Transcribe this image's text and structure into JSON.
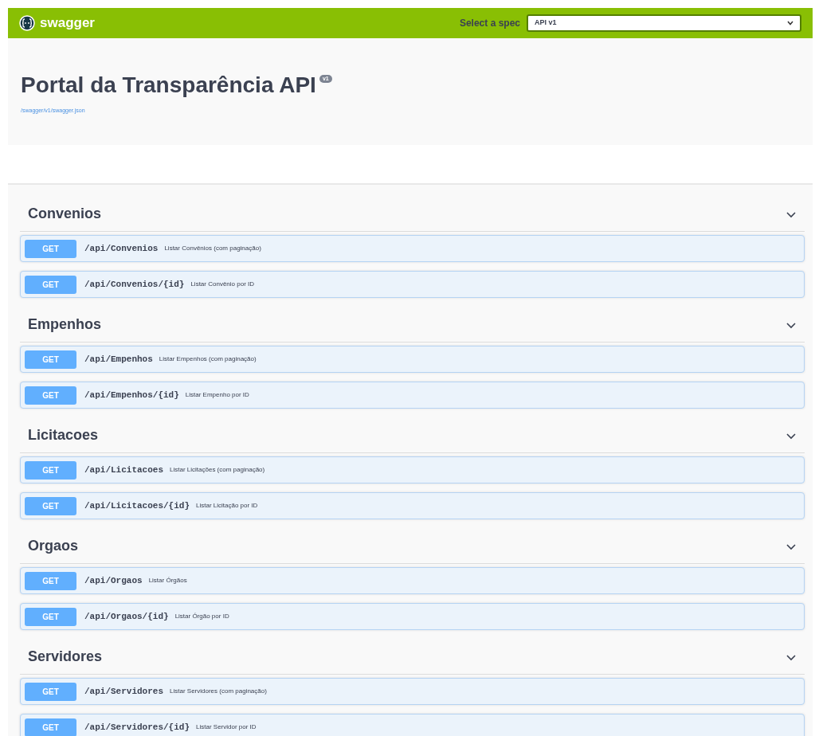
{
  "topbar": {
    "brand": "swagger",
    "spec_label": "Select a spec",
    "spec_value": "API v1"
  },
  "info": {
    "title": "Portal da Transparência API",
    "version": "v1",
    "spec_link": "/swagger/v1/swagger.json"
  },
  "tags": [
    {
      "name": "Convenios",
      "expanded": true,
      "operations": [
        {
          "method": "GET",
          "path": "/api/Convenios",
          "summary": "Listar Convênios (com paginação)"
        },
        {
          "method": "GET",
          "path": "/api/Convenios/{id}",
          "summary": "Listar Convênio por ID"
        }
      ]
    },
    {
      "name": "Empenhos",
      "expanded": true,
      "operations": [
        {
          "method": "GET",
          "path": "/api/Empenhos",
          "summary": "Listar Empenhos (com paginação)"
        },
        {
          "method": "GET",
          "path": "/api/Empenhos/{id}",
          "summary": "Listar Empenho por ID"
        }
      ]
    },
    {
      "name": "Licitacoes",
      "expanded": true,
      "operations": [
        {
          "method": "GET",
          "path": "/api/Licitacoes",
          "summary": "Listar Licitações (com paginação)"
        },
        {
          "method": "GET",
          "path": "/api/Licitacoes/{id}",
          "summary": "Listar Licitação por ID"
        }
      ]
    },
    {
      "name": "Orgaos",
      "expanded": true,
      "operations": [
        {
          "method": "GET",
          "path": "/api/Orgaos",
          "summary": "Listar Órgãos"
        },
        {
          "method": "GET",
          "path": "/api/Orgaos/{id}",
          "summary": "Listar Órgão por ID"
        }
      ]
    },
    {
      "name": "Servidores",
      "expanded": true,
      "operations": [
        {
          "method": "GET",
          "path": "/api/Servidores",
          "summary": "Listar Servidores (com paginação)"
        },
        {
          "method": "GET",
          "path": "/api/Servidores/{id}",
          "summary": "Listar Servidor por ID"
        }
      ]
    }
  ]
}
